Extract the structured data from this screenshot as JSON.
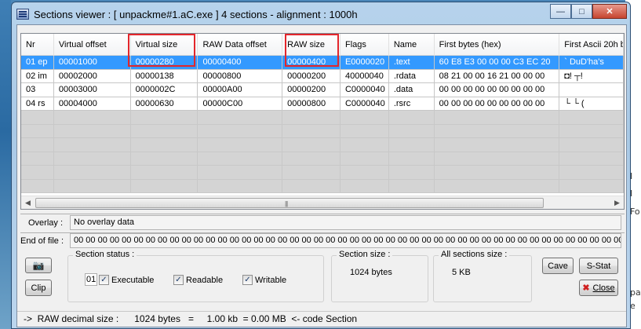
{
  "window": {
    "title": "Sections viewer :  [ unpackme#1.aC.exe ] 4 sections - alignment : 1000h",
    "min_label": "—",
    "max_label": "□",
    "close_label": "✕"
  },
  "table": {
    "columns": [
      "Nr",
      "Virtual offset",
      "Virtual size",
      "RAW Data offset",
      "RAW size",
      "Flags",
      "Name",
      "First bytes (hex)",
      "First Ascii 20h b"
    ],
    "rows": [
      [
        "01 ep",
        "00001000",
        "00000280",
        "00000400",
        "00000400",
        "E0000020",
        ".text",
        "60 E8 E3 00 00 00 C3 EC 20",
        "`    DuD'ha's"
      ],
      [
        "02 im",
        "00002000",
        "00000138",
        "00000800",
        "00000200",
        "40000040",
        ".rdata",
        "08 21 00 00 16 21 00 00 00",
        "◘!  ┬!"
      ],
      [
        "03",
        "00003000",
        "0000002C",
        "00000A00",
        "00000200",
        "C0000040",
        ".data",
        "00 00 00 00 00 00 00 00 00",
        ""
      ],
      [
        "04 rs",
        "00004000",
        "00000630",
        "00000C00",
        "00000800",
        "C0000040",
        ".rsrc",
        "00 00 00 00 00 00 00 00 00",
        "            └ └  ("
      ]
    ],
    "selected_row": 0
  },
  "overlay": {
    "label": "Overlay :",
    "value": "No overlay data"
  },
  "eof": {
    "label": "End of file :",
    "value": "00 00 00 00 00 00 00 00 00 00 00 00 00 00 00 00 00 00 00 00 00 00 00 00 00 00 00 00 00 00 00 00 00 00 00 00 00 00 00 00 00 00 00 00 00 00 00 00 00 00   |"
  },
  "section_status": {
    "title": "Section status :",
    "field_value": "01",
    "executable": {
      "label": "Executable",
      "checked": true
    },
    "readable": {
      "label": "Readable",
      "checked": true
    },
    "writable": {
      "label": "Writable",
      "checked": true
    }
  },
  "section_size": {
    "title": "Section size :",
    "value": "1024 bytes"
  },
  "all_sections_size": {
    "title": "All sections size :",
    "value": "5 KB"
  },
  "buttons": {
    "clip": "Clip",
    "cave": "Cave",
    "sstat": "S-Stat",
    "close": "Close"
  },
  "statusbar": {
    "text": "->  RAW decimal size :      1024 bytes   =     1.00 kb  = 0.00 MB  <- code Section"
  },
  "desktop_fragments": [
    "I",
    "I",
    "Fo",
    "pa",
    "e"
  ],
  "colors": {
    "selection": "#3399ff",
    "highlight_box": "#e3262b"
  }
}
